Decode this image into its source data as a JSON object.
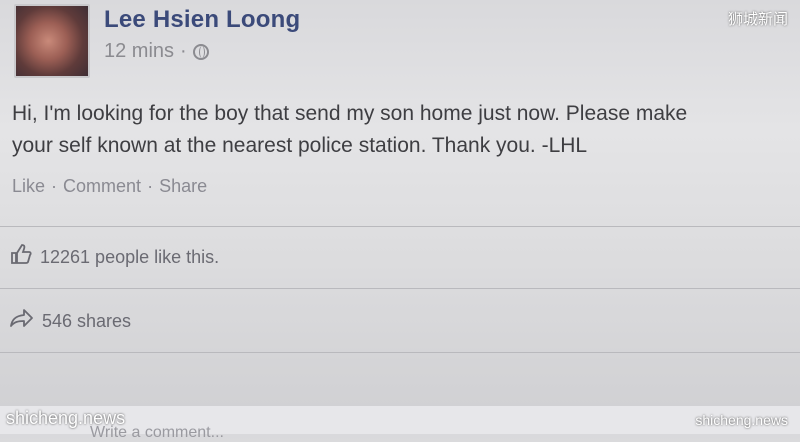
{
  "post": {
    "author": "Lee Hsien Loong",
    "time": "12 mins",
    "privacy_separator": "·",
    "privacy_icon": "globe-icon",
    "text_line1": "Hi, I'm looking for the boy that send my son home just now. Please make",
    "text_line2": "your self known at the nearest police station. Thank you. -LHL",
    "actions": {
      "like": "Like",
      "comment": "Comment",
      "share": "Share",
      "separator": "·"
    },
    "likes_text": "12261 people like this.",
    "shares_text": "546 shares",
    "comment_placeholder": "Write a comment..."
  },
  "watermarks": {
    "top_right": "狮城新闻",
    "bottom_left": "shicheng.news",
    "bottom_right": "shicheng.news"
  }
}
